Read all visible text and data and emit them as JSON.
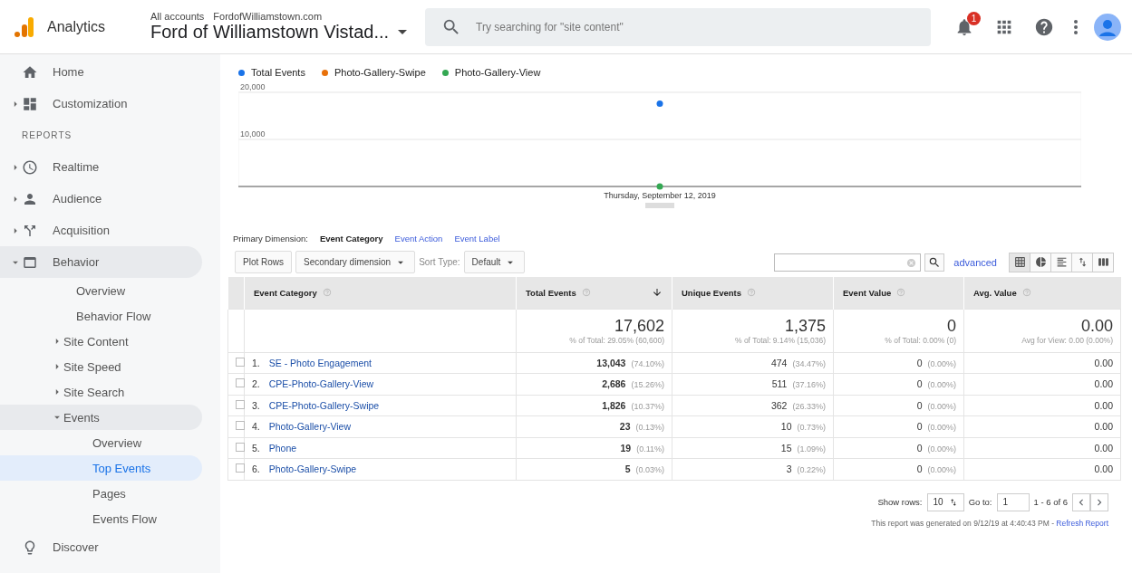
{
  "header": {
    "product": "Analytics",
    "breadcrumb": [
      "All accounts",
      "FordofWilliamstown.com"
    ],
    "property": "Ford of Williamstown Vistad...",
    "search": {
      "placeholder": "Try searching for \"site content\""
    },
    "notifications": "1"
  },
  "sidebar": {
    "items": [
      {
        "label": "Home",
        "selected": false
      },
      {
        "label": "Customization",
        "selected": false,
        "expanded": false
      },
      {
        "kind": "heading",
        "label": "REPORTS"
      },
      {
        "label": "Realtime",
        "selected": false,
        "expanded": false
      },
      {
        "label": "Audience",
        "selected": false,
        "expanded": false
      },
      {
        "label": "Acquisition",
        "selected": false,
        "expanded": false
      },
      {
        "label": "Behavior",
        "selected": false,
        "expanded": true,
        "children": [
          {
            "label": "Overview",
            "selected": false
          },
          {
            "label": "Behavior Flow",
            "selected": false
          },
          {
            "label": "Site Content",
            "selected": false,
            "expanded": false
          },
          {
            "label": "Site Speed",
            "selected": false,
            "expanded": false
          },
          {
            "label": "Site Search",
            "selected": false,
            "expanded": false
          },
          {
            "label": "Events",
            "selected": false,
            "expanded": true,
            "children": [
              {
                "label": "Overview",
                "selected": false
              },
              {
                "label": "Top Events",
                "selected": true
              },
              {
                "label": "Pages",
                "selected": false
              },
              {
                "label": "Events Flow",
                "selected": false
              }
            ]
          }
        ]
      },
      {
        "label": "Discover",
        "selected": false
      }
    ]
  },
  "chart_data": {
    "type": "line",
    "categories": [
      "Thursday, September 12, 2019"
    ],
    "ylim": [
      0,
      20000
    ],
    "yticks": [
      {
        "value": 10000,
        "label": "10,000"
      },
      {
        "value": 20000,
        "label": "20,000"
      }
    ],
    "series": [
      {
        "name": "Total Events",
        "color": "#1a73e8",
        "marker": "circle",
        "values": [
          17602
        ]
      },
      {
        "name": "Photo-Gallery-Swipe",
        "color": "#e8710a",
        "marker": "circle",
        "values": [
          null
        ]
      },
      {
        "name": "Photo-Gallery-View",
        "color": "#34a853",
        "marker": "circle",
        "values": [
          23
        ]
      }
    ]
  },
  "dimension": {
    "label": "Primary Dimension:",
    "options": [
      {
        "label": "Event Category",
        "selected": true
      },
      {
        "label": "Event Action",
        "selected": false
      },
      {
        "label": "Event Label",
        "selected": false
      }
    ]
  },
  "report_toolbar": {
    "plot_rows": "Plot Rows",
    "secondary": "Secondary dimension",
    "sort_label": "Sort Type:",
    "sort_value": "Default",
    "advanced": "advanced",
    "views": [
      {
        "selected": true
      },
      {
        "selected": false
      },
      {
        "selected": false
      },
      {
        "selected": false
      },
      {
        "selected": false
      }
    ]
  },
  "table": {
    "columns": [
      {
        "label": "Event Category",
        "sorted": false
      },
      {
        "label": "Total Events",
        "sorted": true
      },
      {
        "label": "Unique Events",
        "sorted": false
      },
      {
        "label": "Event Value",
        "sorted": false
      },
      {
        "label": "Avg. Value",
        "sorted": false
      }
    ],
    "totals": [
      {
        "value": "17,602",
        "note": "% of Total: 29.05% (60,600)"
      },
      {
        "value": "1,375",
        "note": "% of Total: 9.14% (15,036)"
      },
      {
        "value": "0",
        "note": "% of Total: 0.00% (0)"
      },
      {
        "value": "0.00",
        "note": "Avg for View: 0.00 (0.00%)"
      }
    ],
    "rows": [
      {
        "checked": false,
        "index": "1.",
        "name": "SE - Photo Engagement",
        "total": "13,043",
        "total_pct": "(74.10%)",
        "unique": "474",
        "unique_pct": "(34.47%)",
        "value": "0",
        "value_pct": "(0.00%)",
        "avg": "0.00"
      },
      {
        "checked": false,
        "index": "2.",
        "name": "CPE-Photo-Gallery-View",
        "total": "2,686",
        "total_pct": "(15.26%)",
        "unique": "511",
        "unique_pct": "(37.16%)",
        "value": "0",
        "value_pct": "(0.00%)",
        "avg": "0.00"
      },
      {
        "checked": false,
        "index": "3.",
        "name": "CPE-Photo-Gallery-Swipe",
        "total": "1,826",
        "total_pct": "(10.37%)",
        "unique": "362",
        "unique_pct": "(26.33%)",
        "value": "0",
        "value_pct": "(0.00%)",
        "avg": "0.00"
      },
      {
        "checked": false,
        "index": "4.",
        "name": "Photo-Gallery-View",
        "total": "23",
        "total_pct": "(0.13%)",
        "unique": "10",
        "unique_pct": "(0.73%)",
        "value": "0",
        "value_pct": "(0.00%)",
        "avg": "0.00"
      },
      {
        "checked": false,
        "index": "5.",
        "name": "Phone",
        "total": "19",
        "total_pct": "(0.11%)",
        "unique": "15",
        "unique_pct": "(1.09%)",
        "value": "0",
        "value_pct": "(0.00%)",
        "avg": "0.00"
      },
      {
        "checked": false,
        "index": "6.",
        "name": "Photo-Gallery-Swipe",
        "total": "5",
        "total_pct": "(0.03%)",
        "unique": "3",
        "unique_pct": "(0.22%)",
        "value": "0",
        "value_pct": "(0.00%)",
        "avg": "0.00"
      }
    ]
  },
  "pagination": {
    "show_rows_label": "Show rows:",
    "show_rows": "10",
    "goto_label": "Go to:",
    "goto": "1",
    "range": "1 - 6 of 6"
  },
  "footer": {
    "text": "This report was generated on 9/12/19 at 4:40:43 PM - ",
    "link": "Refresh Report"
  }
}
